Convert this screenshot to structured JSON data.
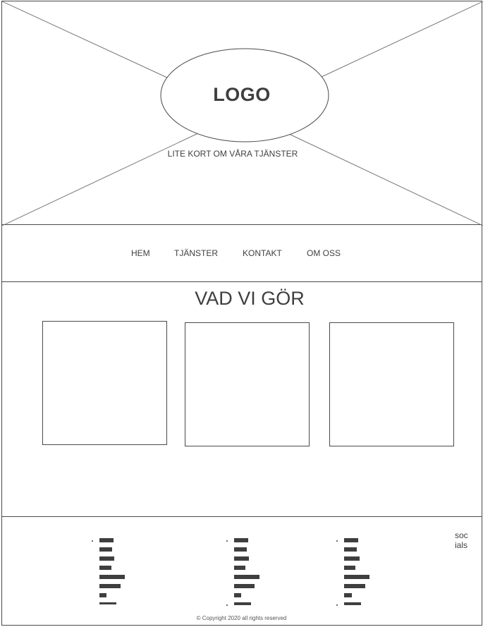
{
  "hero": {
    "logo_text": "LOGO",
    "tagline": "LITE KORT OM VÅRA TJÄNSTER"
  },
  "nav": {
    "items": [
      {
        "label": "HEM"
      },
      {
        "label": "TJÄNSTER"
      },
      {
        "label": "KONTAKT"
      },
      {
        "label": "OM OSS"
      }
    ]
  },
  "content": {
    "title": "VAD VI GÖR"
  },
  "footer": {
    "socials_text": "socials",
    "copyright": "© Copyright 2020 all rights reserved"
  },
  "colors": {
    "stroke": "#4a4a4a",
    "text": "#3f3f3f",
    "background": "#ffffff"
  }
}
